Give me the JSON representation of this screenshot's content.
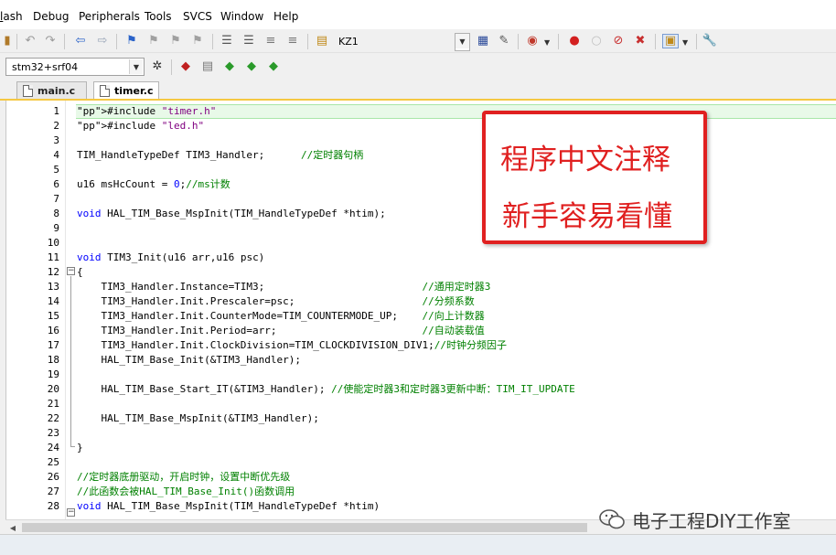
{
  "menu": [
    "lash",
    "Debug",
    "Peripherals",
    "Tools",
    "SVCS",
    "Window",
    "Help"
  ],
  "toolbar": {
    "find_target": "KZ1",
    "target_select": "stm32+srf04"
  },
  "tabs": [
    {
      "label": "main.c",
      "active": false
    },
    {
      "label": "timer.c",
      "active": true
    }
  ],
  "editor": {
    "line_numbers": [
      "1",
      "2",
      "3",
      "4",
      "5",
      "6",
      "7",
      "8",
      "9",
      "10",
      "11",
      "12",
      "13",
      "14",
      "15",
      "16",
      "17",
      "18",
      "19",
      "20",
      "21",
      "22",
      "23",
      "24",
      "25",
      "26",
      "27",
      "28"
    ],
    "lines": [
      "#include \"timer.h\"",
      "#include \"led.h\"",
      "",
      "TIM_HandleTypeDef TIM3_Handler;      //定时器句柄",
      "",
      "u16 msHcCount = 0;//ms计数",
      "",
      "void HAL_TIM_Base_MspInit(TIM_HandleTypeDef *htim);",
      "",
      "",
      "void TIM3_Init(u16 arr,u16 psc)",
      "{",
      "    TIM3_Handler.Instance=TIM3;                          //通用定时器3",
      "    TIM3_Handler.Init.Prescaler=psc;                     //分频系数",
      "    TIM3_Handler.Init.CounterMode=TIM_COUNTERMODE_UP;    //向上计数器",
      "    TIM3_Handler.Init.Period=arr;                        //自动装载值",
      "    TIM3_Handler.Init.ClockDivision=TIM_CLOCKDIVISION_DIV1;//时钟分频因子",
      "    HAL_TIM_Base_Init(&TIM3_Handler);",
      "",
      "    HAL_TIM_Base_Start_IT(&TIM3_Handler); //使能定时器3和定时器3更新中断：TIM_IT_UPDATE",
      "",
      "    HAL_TIM_Base_MspInit(&TIM3_Handler);",
      "",
      "}",
      "",
      "//定时器底册驱动，开启时钟，设置中断优先级",
      "//此函数会被HAL_TIM_Base_Init()函数调用",
      "void HAL_TIM_Base_MspInit(TIM_HandleTypeDef *htim)"
    ]
  },
  "annotation": {
    "line1": "程序中文注释",
    "line2": "新手容易看懂"
  },
  "watermark": "电子工程DIY工作室",
  "colors": {
    "keyword": "#0000ff",
    "string": "#800080",
    "comment": "#008000",
    "annotation_red": "#e02020",
    "tab_accent": "#f5c842"
  }
}
